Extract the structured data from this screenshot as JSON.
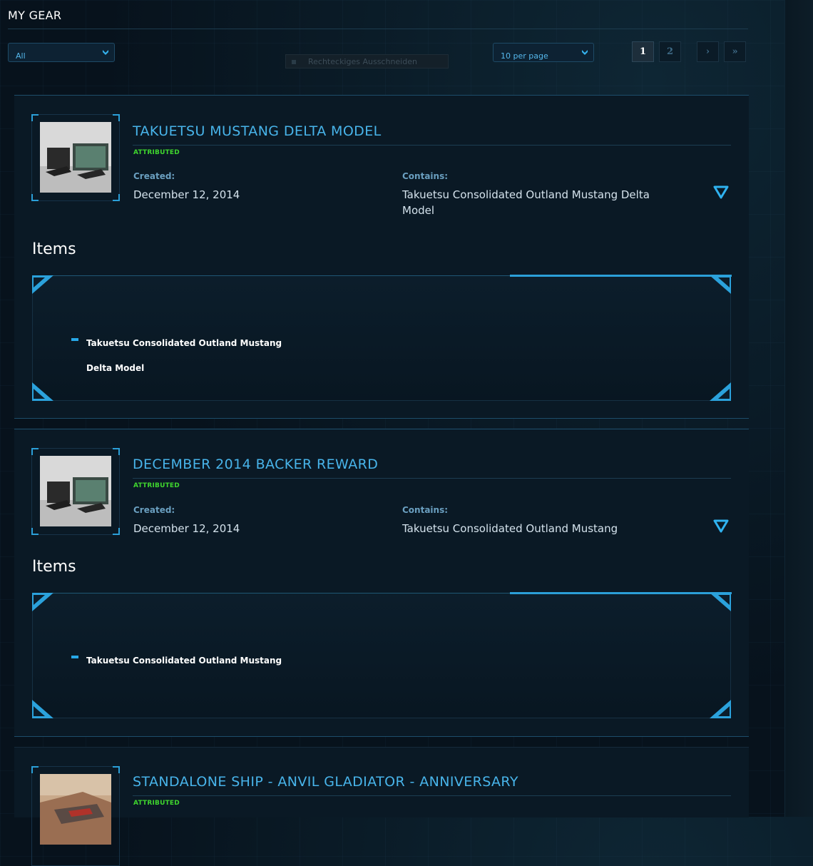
{
  "page": {
    "title": "MY GEAR"
  },
  "filters": {
    "category": {
      "value": "All"
    },
    "per_page": {
      "value": "10 per page"
    },
    "ghost_tooltip": "Rechteckiges Ausschneiden"
  },
  "pagination": {
    "pages": [
      "1",
      "2"
    ],
    "current": "1",
    "next": "›",
    "last": "»"
  },
  "pledges": [
    {
      "title": "TAKUETSU MUSTANG DELTA MODEL",
      "badge": "ATTRIBUTED",
      "created_label": "Created:",
      "created": "December 12, 2014",
      "contains_label": "Contains:",
      "contains": "Takuetsu Consolidated Outland Mustang Delta Model",
      "items_heading": "Items",
      "items": [
        "Takuetsu Consolidated Outland Mustang Delta Model"
      ]
    },
    {
      "title": "DECEMBER 2014 BACKER REWARD",
      "badge": "ATTRIBUTED",
      "created_label": "Created:",
      "created": "December 12, 2014",
      "contains_label": "Contains:",
      "contains": "Takuetsu Consolidated Outland Mustang",
      "items_heading": "Items",
      "items": [
        "Takuetsu Consolidated Outland Mustang"
      ]
    },
    {
      "title": "STANDALONE SHIP - ANVIL GLADIATOR - ANNIVERSARY",
      "badge": "ATTRIBUTED"
    }
  ],
  "icons": {
    "dropdown": "chevron-down-icon",
    "expand": "triangle-down-icon"
  },
  "colors": {
    "accent": "#2b9fd8",
    "title": "#48b4ea",
    "attributed": "#3fd52e",
    "bg": "#07121c"
  }
}
